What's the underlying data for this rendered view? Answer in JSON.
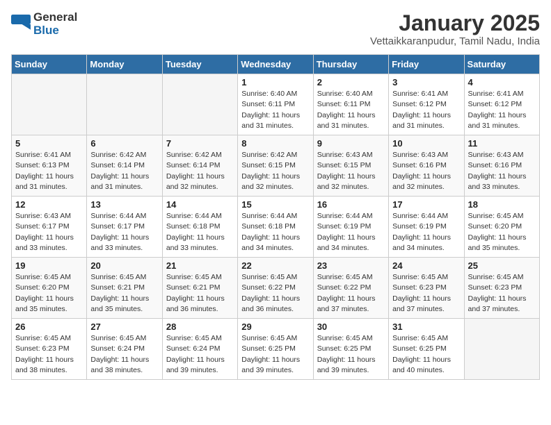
{
  "header": {
    "logo": {
      "general": "General",
      "blue": "Blue"
    },
    "title": "January 2025",
    "subtitle": "Vettaikkaranpudur, Tamil Nadu, India"
  },
  "weekdays": [
    "Sunday",
    "Monday",
    "Tuesday",
    "Wednesday",
    "Thursday",
    "Friday",
    "Saturday"
  ],
  "weeks": [
    [
      {
        "day": "",
        "info": ""
      },
      {
        "day": "",
        "info": ""
      },
      {
        "day": "",
        "info": ""
      },
      {
        "day": "1",
        "info": "Sunrise: 6:40 AM\nSunset: 6:11 PM\nDaylight: 11 hours\nand 31 minutes."
      },
      {
        "day": "2",
        "info": "Sunrise: 6:40 AM\nSunset: 6:11 PM\nDaylight: 11 hours\nand 31 minutes."
      },
      {
        "day": "3",
        "info": "Sunrise: 6:41 AM\nSunset: 6:12 PM\nDaylight: 11 hours\nand 31 minutes."
      },
      {
        "day": "4",
        "info": "Sunrise: 6:41 AM\nSunset: 6:12 PM\nDaylight: 11 hours\nand 31 minutes."
      }
    ],
    [
      {
        "day": "5",
        "info": "Sunrise: 6:41 AM\nSunset: 6:13 PM\nDaylight: 11 hours\nand 31 minutes."
      },
      {
        "day": "6",
        "info": "Sunrise: 6:42 AM\nSunset: 6:14 PM\nDaylight: 11 hours\nand 31 minutes."
      },
      {
        "day": "7",
        "info": "Sunrise: 6:42 AM\nSunset: 6:14 PM\nDaylight: 11 hours\nand 32 minutes."
      },
      {
        "day": "8",
        "info": "Sunrise: 6:42 AM\nSunset: 6:15 PM\nDaylight: 11 hours\nand 32 minutes."
      },
      {
        "day": "9",
        "info": "Sunrise: 6:43 AM\nSunset: 6:15 PM\nDaylight: 11 hours\nand 32 minutes."
      },
      {
        "day": "10",
        "info": "Sunrise: 6:43 AM\nSunset: 6:16 PM\nDaylight: 11 hours\nand 32 minutes."
      },
      {
        "day": "11",
        "info": "Sunrise: 6:43 AM\nSunset: 6:16 PM\nDaylight: 11 hours\nand 33 minutes."
      }
    ],
    [
      {
        "day": "12",
        "info": "Sunrise: 6:43 AM\nSunset: 6:17 PM\nDaylight: 11 hours\nand 33 minutes."
      },
      {
        "day": "13",
        "info": "Sunrise: 6:44 AM\nSunset: 6:17 PM\nDaylight: 11 hours\nand 33 minutes."
      },
      {
        "day": "14",
        "info": "Sunrise: 6:44 AM\nSunset: 6:18 PM\nDaylight: 11 hours\nand 33 minutes."
      },
      {
        "day": "15",
        "info": "Sunrise: 6:44 AM\nSunset: 6:18 PM\nDaylight: 11 hours\nand 34 minutes."
      },
      {
        "day": "16",
        "info": "Sunrise: 6:44 AM\nSunset: 6:19 PM\nDaylight: 11 hours\nand 34 minutes."
      },
      {
        "day": "17",
        "info": "Sunrise: 6:44 AM\nSunset: 6:19 PM\nDaylight: 11 hours\nand 34 minutes."
      },
      {
        "day": "18",
        "info": "Sunrise: 6:45 AM\nSunset: 6:20 PM\nDaylight: 11 hours\nand 35 minutes."
      }
    ],
    [
      {
        "day": "19",
        "info": "Sunrise: 6:45 AM\nSunset: 6:20 PM\nDaylight: 11 hours\nand 35 minutes."
      },
      {
        "day": "20",
        "info": "Sunrise: 6:45 AM\nSunset: 6:21 PM\nDaylight: 11 hours\nand 35 minutes."
      },
      {
        "day": "21",
        "info": "Sunrise: 6:45 AM\nSunset: 6:21 PM\nDaylight: 11 hours\nand 36 minutes."
      },
      {
        "day": "22",
        "info": "Sunrise: 6:45 AM\nSunset: 6:22 PM\nDaylight: 11 hours\nand 36 minutes."
      },
      {
        "day": "23",
        "info": "Sunrise: 6:45 AM\nSunset: 6:22 PM\nDaylight: 11 hours\nand 37 minutes."
      },
      {
        "day": "24",
        "info": "Sunrise: 6:45 AM\nSunset: 6:23 PM\nDaylight: 11 hours\nand 37 minutes."
      },
      {
        "day": "25",
        "info": "Sunrise: 6:45 AM\nSunset: 6:23 PM\nDaylight: 11 hours\nand 37 minutes."
      }
    ],
    [
      {
        "day": "26",
        "info": "Sunrise: 6:45 AM\nSunset: 6:23 PM\nDaylight: 11 hours\nand 38 minutes."
      },
      {
        "day": "27",
        "info": "Sunrise: 6:45 AM\nSunset: 6:24 PM\nDaylight: 11 hours\nand 38 minutes."
      },
      {
        "day": "28",
        "info": "Sunrise: 6:45 AM\nSunset: 6:24 PM\nDaylight: 11 hours\nand 39 minutes."
      },
      {
        "day": "29",
        "info": "Sunrise: 6:45 AM\nSunset: 6:25 PM\nDaylight: 11 hours\nand 39 minutes."
      },
      {
        "day": "30",
        "info": "Sunrise: 6:45 AM\nSunset: 6:25 PM\nDaylight: 11 hours\nand 39 minutes."
      },
      {
        "day": "31",
        "info": "Sunrise: 6:45 AM\nSunset: 6:25 PM\nDaylight: 11 hours\nand 40 minutes."
      },
      {
        "day": "",
        "info": ""
      }
    ]
  ]
}
